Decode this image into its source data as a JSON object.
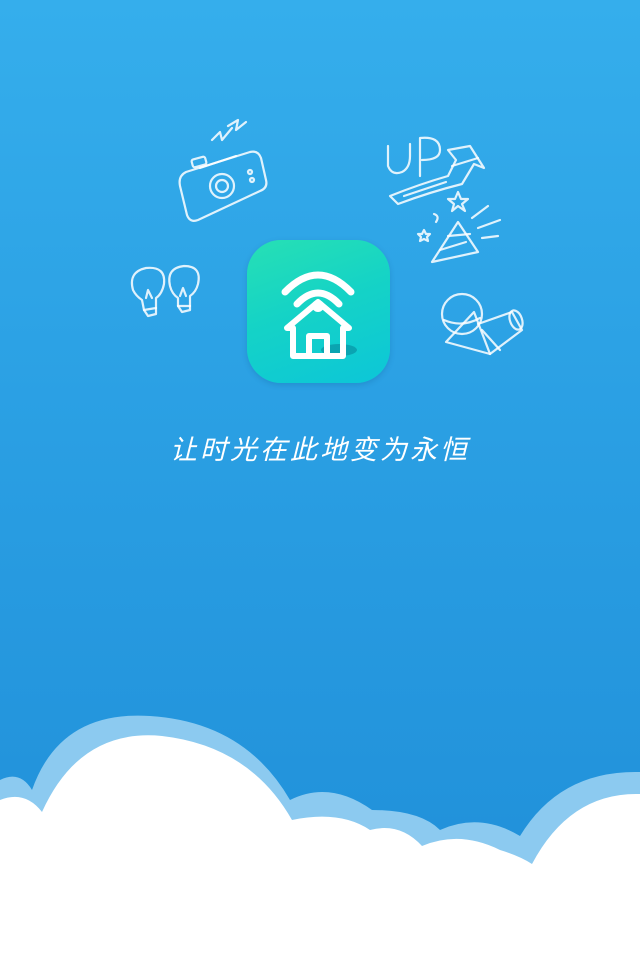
{
  "splash": {
    "tagline": "让时光在此地变为永恒"
  },
  "app_icon": {
    "icon": "wifi-home-icon",
    "gradient_start": "#27e0b4",
    "gradient_end": "#0cc6d8"
  },
  "doodles": {
    "camera": "camera-doodle-icon",
    "lightbulbs": "lightbulb-doodle-icon",
    "up_arrow": "up-arrow-doodle-icon",
    "stars": "stars-doodle-icon",
    "party_hat": "party-hat-doodle-icon",
    "shapes": "geometric-shapes-doodle-icon",
    "up_text": "UP"
  },
  "colors": {
    "background_top": "#35aeec",
    "background_bottom": "#1f8ed8",
    "cloud_back": "#8ccaf0",
    "cloud_front": "#ffffff"
  }
}
